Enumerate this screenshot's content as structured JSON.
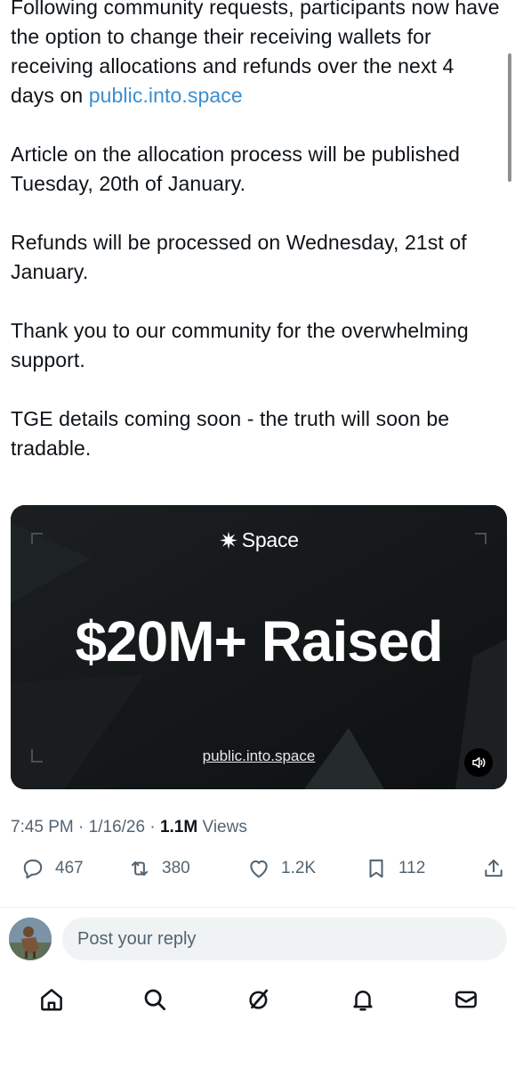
{
  "tweet": {
    "paragraphs": [
      {
        "text_before": "Following community requests, participants now have the option to change their receiving wallets for receiving allocations and refunds over the next 4 days on ",
        "link": "public.into.space"
      },
      {
        "text": "Article on the allocation process will be published Tuesday, 20th of January."
      },
      {
        "text": "Refunds will be processed on Wednesday, 21st of January."
      },
      {
        "text": "Thank you to our community for the overwhelming support."
      },
      {
        "text": "TGE details coming soon - the truth will soon be tradable."
      }
    ]
  },
  "media": {
    "brand": "Space",
    "brand_icon": "asterisk-star-icon",
    "headline": "$20M+ Raised",
    "url": "public.into.space"
  },
  "meta": {
    "time": "7:45 PM",
    "date": "1/16/26",
    "views_count": "1.1M",
    "views_label": "Views"
  },
  "actions": {
    "replies": "467",
    "reposts": "380",
    "likes": "1.2K",
    "bookmarks": "112"
  },
  "reply": {
    "placeholder": "Post your reply"
  },
  "colors": {
    "link": "#1d9bf0",
    "text": "#0f1419",
    "muted": "#536471",
    "media_bg": "#121516"
  }
}
